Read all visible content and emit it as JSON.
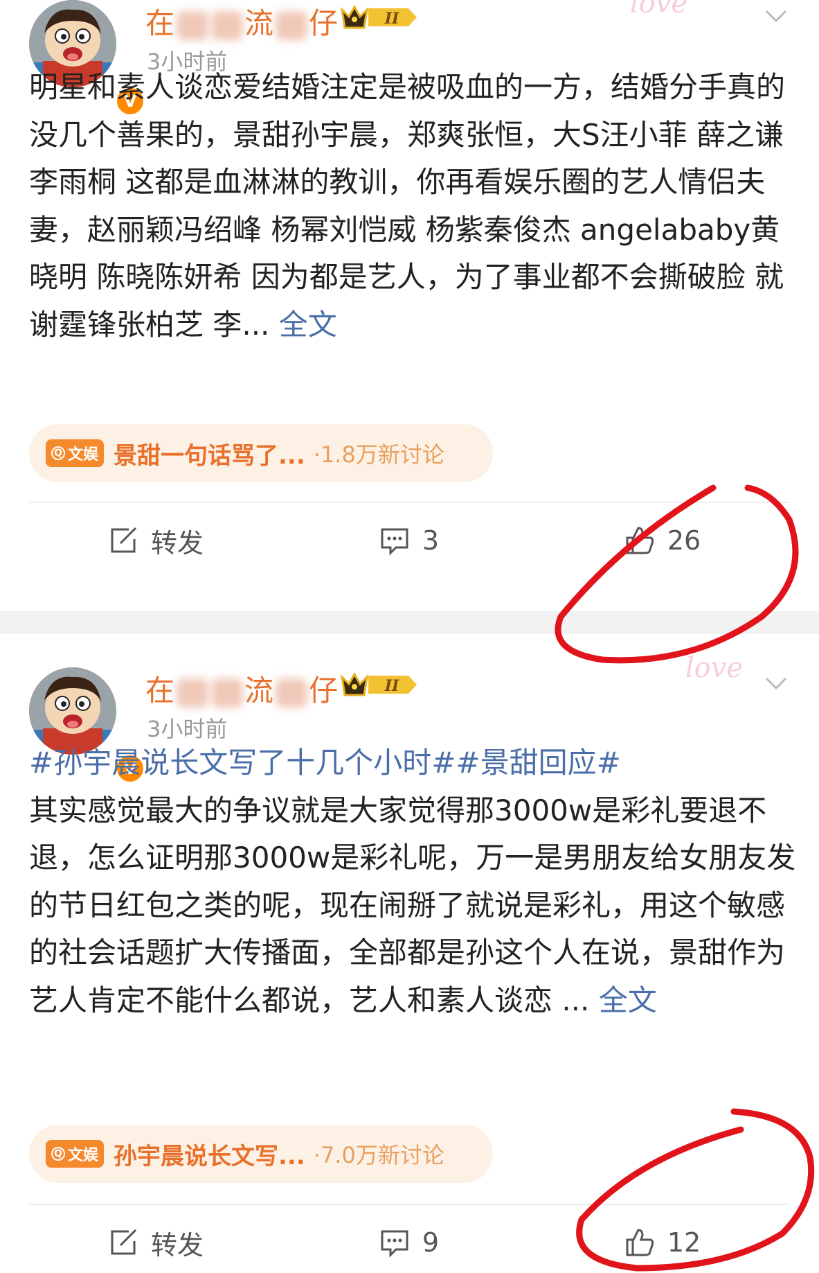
{
  "posts": [
    {
      "username_parts": [
        "在",
        "流",
        "仔"
      ],
      "vip_level": "II",
      "time": "3小时前",
      "body": "明星和素人谈恋爱结婚注定是被吸血的一方，结婚分手真的没几个善果的，景甜孙宇晨，郑爽张恒，大S汪小菲 薛之谦李雨桐 这都是血淋淋的教训，你再看娱乐圈的艺人情侣夫妻，赵丽颖冯绍峰 杨幂刘恺威 杨紫秦俊杰 angelababy黄晓明 陈晓陈妍希 因为都是艺人，为了事业都不会撕破脸 就谢霆锋张柏芝 李...",
      "full_text_link": "全文",
      "topic": {
        "tag": "文娱",
        "title": "景甜一句话骂了...",
        "count": "·1.8万新讨论"
      },
      "actions": {
        "repost": "转发",
        "comments": "3",
        "likes": "26"
      }
    },
    {
      "username_parts": [
        "在",
        "流",
        "仔"
      ],
      "vip_level": "II",
      "time": "3小时前",
      "hashtags": "#孙宇晨说长文写了十几个小时##景甜回应#",
      "body": "其实感觉最大的争议就是大家觉得那3000w是彩礼要退不退，怎么证明那3000w是彩礼呢，万一是男朋友给女朋友发的节日红包之类的呢，现在闹掰了就说是彩礼，用这个敏感的社会话题扩大传播面，全部都是孙这个人在说，景甜作为艺人肯定不能什么都说，艺人和素人谈恋 ...",
      "full_text_link": "全文",
      "topic": {
        "tag": "文娱",
        "title": "孙宇晨说长文写...",
        "count": "·7.0万新讨论"
      },
      "actions": {
        "repost": "转发",
        "comments": "9",
        "likes": "12"
      }
    }
  ],
  "decor": {
    "love_text": "love"
  },
  "colors": {
    "username": "#e8702a",
    "link": "#4a6ea8",
    "annotation": "#e0141a",
    "topic_bg": "#fdf0e4"
  }
}
